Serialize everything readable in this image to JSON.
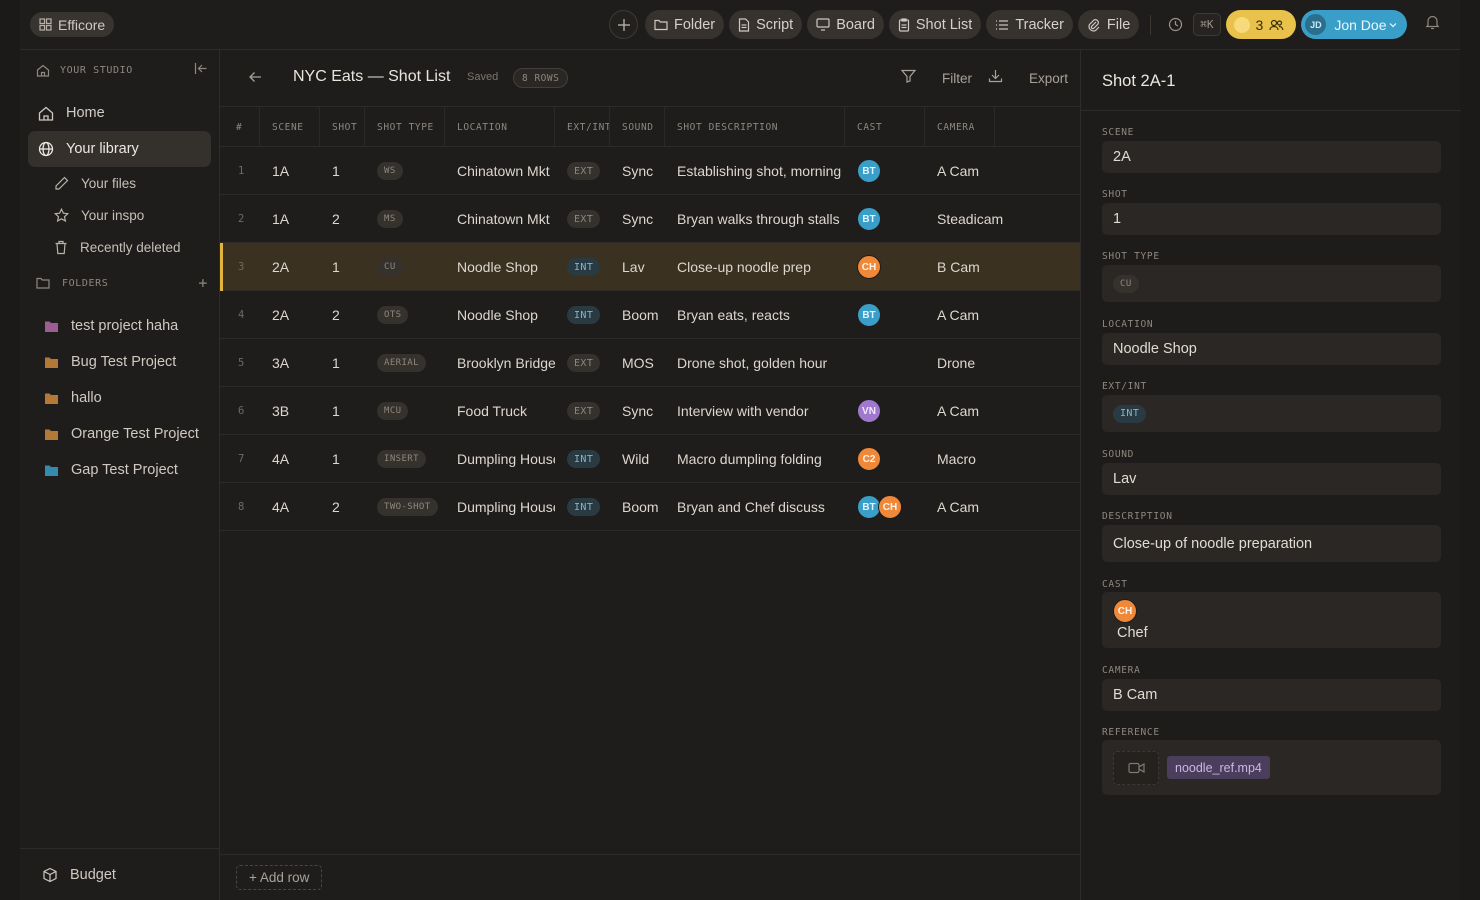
{
  "app": {
    "name": "Efficore"
  },
  "topbar": {
    "actions": [
      "Folder",
      "Script",
      "Board",
      "Shot List",
      "Tracker",
      "File"
    ],
    "shortcut": "⌘K",
    "credits": "3",
    "user_initials": "JD",
    "user_name": "Jon Doe"
  },
  "sidebar": {
    "studio_label": "YOUR STUDIO",
    "nav": {
      "home": "Home",
      "library": "Your library",
      "files": "Your files",
      "inspo": "Your inspo",
      "deleted": "Recently deleted"
    },
    "folders_label": "FOLDERS",
    "folders": [
      {
        "name": "test project haha",
        "color": "#b06aa8"
      },
      {
        "name": "Bug Test Project",
        "color": "#d08a3c"
      },
      {
        "name": "hallo",
        "color": "#d08a3c"
      },
      {
        "name": "Orange Test Project",
        "color": "#d08a3c"
      },
      {
        "name": "Gap Test Project",
        "color": "#3a9fc8"
      }
    ],
    "budget": "Budget"
  },
  "main": {
    "title": "NYC Eats — Shot List",
    "saved": "Saved",
    "rows_badge": "8 ROWS",
    "filter": "Filter",
    "export": "Export",
    "add_row": "+ Add row",
    "columns": [
      "#",
      "SCENE",
      "SHOT",
      "SHOT TYPE",
      "LOCATION",
      "EXT/INT",
      "SOUND",
      "SHOT DESCRIPTION",
      "CAST",
      "CAMERA"
    ],
    "rows": [
      {
        "n": "1",
        "scene": "1A",
        "shot": "1",
        "type": "WS",
        "location": "Chinatown Mkt",
        "extint": "EXT",
        "sound": "Sync",
        "desc": "Establishing shot, morning crowd",
        "cast": [
          "BT"
        ],
        "camera": "A Cam"
      },
      {
        "n": "2",
        "scene": "1A",
        "shot": "2",
        "type": "MS",
        "location": "Chinatown Mkt",
        "extint": "EXT",
        "sound": "Sync",
        "desc": "Bryan walks through stalls",
        "cast": [
          "BT"
        ],
        "camera": "Steadicam"
      },
      {
        "n": "3",
        "scene": "2A",
        "shot": "1",
        "type": "CU",
        "location": "Noodle Shop",
        "extint": "INT",
        "sound": "Lav",
        "desc": "Close-up noodle prep",
        "cast": [
          "CH"
        ],
        "camera": "B Cam"
      },
      {
        "n": "4",
        "scene": "2A",
        "shot": "2",
        "type": "OTS",
        "location": "Noodle Shop",
        "extint": "INT",
        "sound": "Boom",
        "desc": "Bryan eats, reacts",
        "cast": [
          "BT"
        ],
        "camera": "A Cam"
      },
      {
        "n": "5",
        "scene": "3A",
        "shot": "1",
        "type": "AERIAL",
        "location": "Brooklyn Bridge",
        "extint": "EXT",
        "sound": "MOS",
        "desc": "Drone shot, golden hour",
        "cast": [],
        "camera": "Drone"
      },
      {
        "n": "6",
        "scene": "3B",
        "shot": "1",
        "type": "MCU",
        "location": "Food Truck",
        "extint": "EXT",
        "sound": "Sync",
        "desc": "Interview with vendor",
        "cast": [
          "VN"
        ],
        "camera": "A Cam"
      },
      {
        "n": "7",
        "scene": "4A",
        "shot": "1",
        "type": "INSERT",
        "location": "Dumpling House",
        "extint": "INT",
        "sound": "Wild",
        "desc": "Macro dumpling folding",
        "cast": [
          "C2"
        ],
        "camera": "Macro"
      },
      {
        "n": "8",
        "scene": "4A",
        "shot": "2",
        "type": "TWO-SHOT",
        "location": "Dumpling House",
        "extint": "INT",
        "sound": "Boom",
        "desc": "Bryan and Chef discuss",
        "cast": [
          "BT",
          "CH"
        ],
        "camera": "A Cam"
      }
    ]
  },
  "detail": {
    "title": "Shot 2A-1",
    "labels": {
      "scene": "SCENE",
      "shot": "SHOT",
      "shot_type": "SHOT TYPE",
      "location": "LOCATION",
      "extint": "EXT/INT",
      "sound": "SOUND",
      "description": "DESCRIPTION",
      "cast": "CAST",
      "camera": "CAMERA",
      "reference": "REFERENCE"
    },
    "scene": "2A",
    "shot": "1",
    "shot_type": "CU",
    "location": "Noodle Shop",
    "extint": "INT",
    "sound": "Lav",
    "description": "Close-up of noodle preparation",
    "cast_initials": "CH",
    "cast_name": "Chef",
    "camera": "B Cam",
    "reference_file": "noodle_ref.mp4"
  },
  "colors": {
    "accent": "#e2b43c",
    "selected_row": "#3a3121",
    "user": "#3a9fc8",
    "credits": "#e8c24a"
  }
}
